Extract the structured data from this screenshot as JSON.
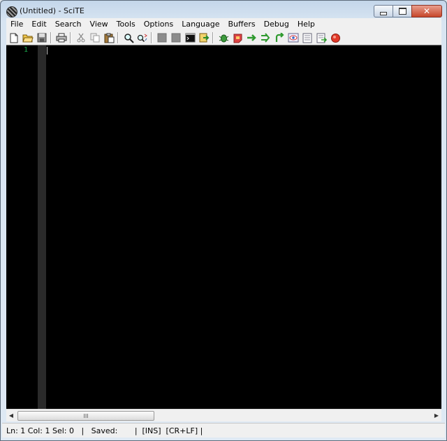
{
  "window": {
    "title": "(Untitled) - SciTE",
    "controls": {
      "minimize_icon": "minimize-icon",
      "maximize_icon": "maximize-icon",
      "close_icon": "close-icon"
    }
  },
  "menu": {
    "items": [
      {
        "label": "File"
      },
      {
        "label": "Edit"
      },
      {
        "label": "Search"
      },
      {
        "label": "View"
      },
      {
        "label": "Tools"
      },
      {
        "label": "Options"
      },
      {
        "label": "Language"
      },
      {
        "label": "Buffers"
      },
      {
        "label": "Debug"
      },
      {
        "label": "Help"
      }
    ]
  },
  "toolbar": {
    "icons": [
      "new-file-icon",
      "open-folder-icon",
      "save-icon",
      "print-icon",
      "cut-icon",
      "copy-icon",
      "paste-icon",
      "find-icon",
      "replace-icon",
      "debug-run-icon",
      "debug-pause-icon",
      "console-icon",
      "step-into-icon",
      "bug-icon",
      "breakpoint-icon",
      "step-over-icon",
      "step-out-icon",
      "return-icon",
      "watch-icon",
      "variables-icon",
      "stack-icon",
      "stop-record-icon"
    ]
  },
  "editor": {
    "background": "#000000",
    "line_number_color": "#1aa84a",
    "lines": [
      {
        "number": "1",
        "text": ""
      }
    ]
  },
  "scrollbar": {
    "thumb_grip": "III"
  },
  "statusbar": {
    "text": "Ln: 1 Col: 1 Sel: 0   |   Saved:       |  [INS]  [CR+LF] |"
  }
}
